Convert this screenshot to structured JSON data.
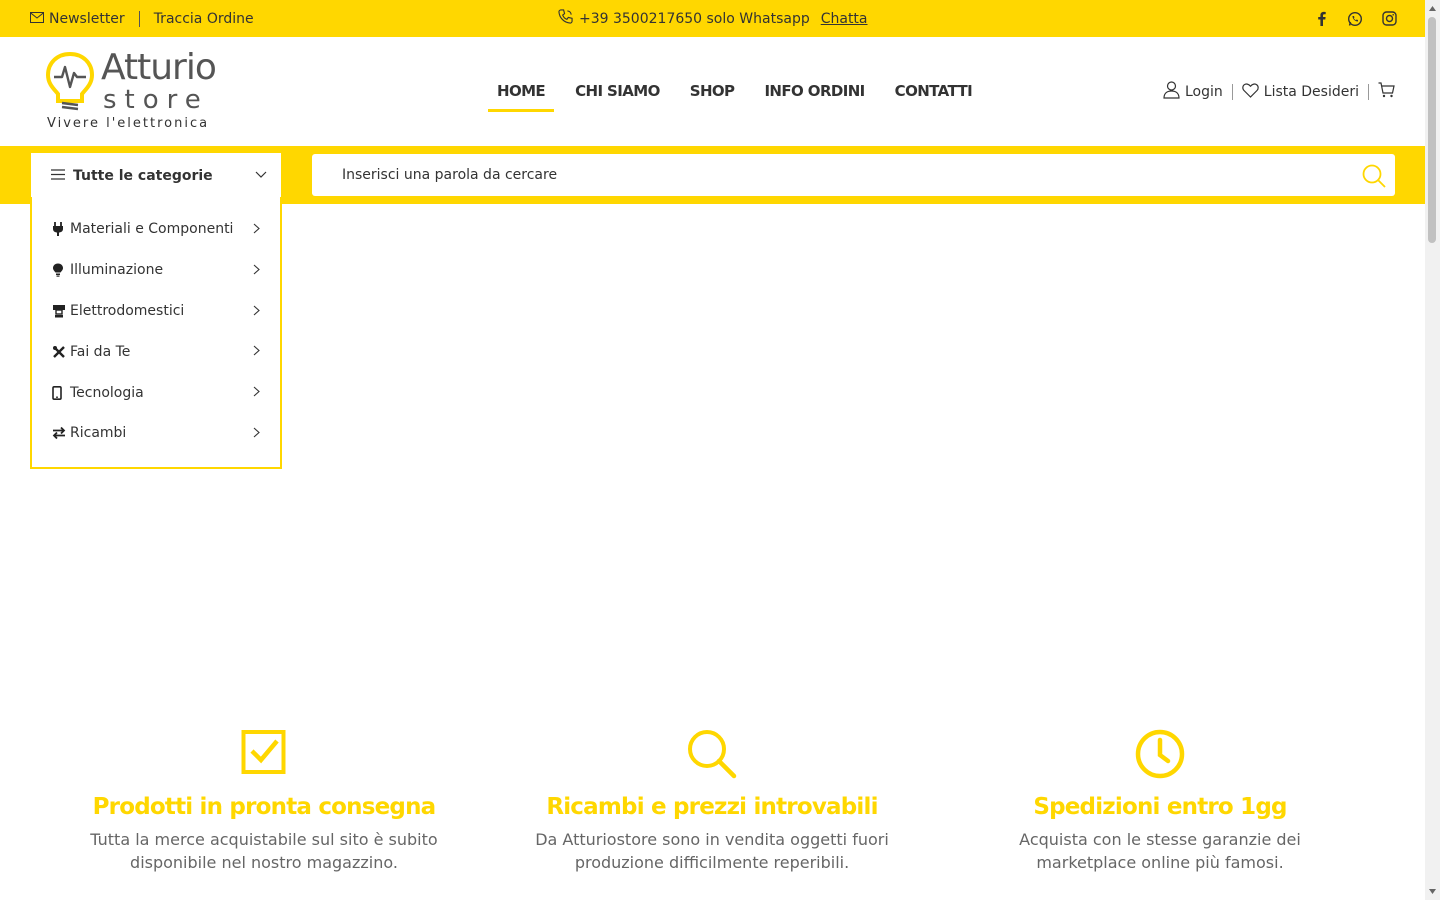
{
  "topbar": {
    "newsletter": "Newsletter",
    "track_order": "Traccia Ordine",
    "phone": "+39 3500217650 solo Whatsapp",
    "chat_link": "Chatta",
    "social": [
      "facebook-icon",
      "whatsapp-icon",
      "instagram-icon"
    ]
  },
  "logo": {
    "brand_line1": "Atturio",
    "brand_line2": "store",
    "tagline": "Vivere l'elettronica"
  },
  "nav": {
    "items": [
      {
        "label": "HOME",
        "active": true
      },
      {
        "label": "CHI SIAMO",
        "active": false
      },
      {
        "label": "SHOP",
        "active": false
      },
      {
        "label": "INFO ORDINI",
        "active": false
      },
      {
        "label": "CONTATTI",
        "active": false
      }
    ]
  },
  "account": {
    "login": "Login",
    "wishlist": "Lista Desideri"
  },
  "categories": {
    "toggle_label": "Tutte le categorie",
    "items": [
      {
        "label": "Materiali e Componenti",
        "icon": "plug-icon"
      },
      {
        "label": "Illuminazione",
        "icon": "lightbulb-icon"
      },
      {
        "label": "Elettrodomestici",
        "icon": "appliance-icon"
      },
      {
        "label": "Fai da Te",
        "icon": "tools-icon"
      },
      {
        "label": "Tecnologia",
        "icon": "phone-icon"
      },
      {
        "label": "Ricambi",
        "icon": "exchange-icon"
      }
    ]
  },
  "search": {
    "placeholder": "Inserisci una parola da cercare"
  },
  "features": [
    {
      "icon": "checkbox-icon",
      "title": "Prodotti in pronta consegna",
      "text": "Tutta la merce acquistabile sul sito è subito disponibile nel nostro magazzino."
    },
    {
      "icon": "search-icon",
      "title": "Ricambi e prezzi introvabili",
      "text": "Da Atturiostore sono in vendita oggetti fuori produzione difficilmente reperibili."
    },
    {
      "icon": "clock-icon",
      "title": "Spedizioni entro 1gg",
      "text": "Acquista con le stesse garanzie dei marketplace online più famosi."
    }
  ],
  "colors": {
    "accent": "#ffd700",
    "text": "#333333",
    "muted": "#666666"
  }
}
